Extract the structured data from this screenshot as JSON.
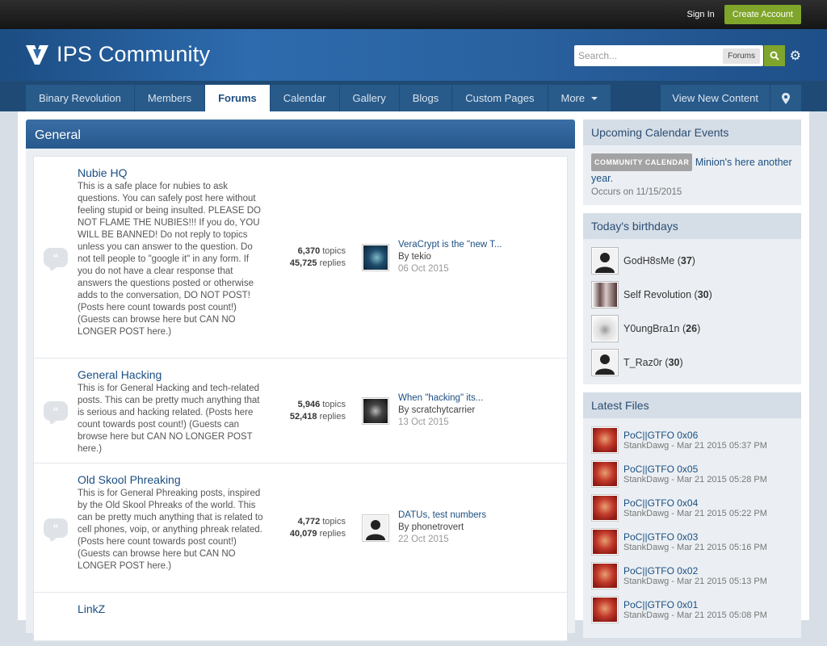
{
  "topbar": {
    "signin": "Sign In",
    "create_account": "Create Account"
  },
  "header": {
    "site_name": "IPS Community",
    "search_placeholder": "Search...",
    "search_scope": "Forums"
  },
  "nav": {
    "tabs": [
      "Binary Revolution",
      "Members",
      "Forums",
      "Calendar",
      "Gallery",
      "Blogs",
      "Custom Pages",
      "More"
    ],
    "active": "Forums",
    "view_new": "View New Content"
  },
  "category": {
    "title": "General",
    "forums": [
      {
        "title": "Nubie HQ",
        "desc": "This is a safe place for nubies to ask questions. You can safely post here without feeling stupid or being insulted. PLEASE DO NOT FLAME THE NUBIES!!! If you do, YOU WILL BE BANNED! Do not reply to topics unless you can answer to the question. Do not tell people to \"google it\" in any form. If you do not have a clear response that answers the questions posted or otherwise adds to the conversation, DO NOT POST! (Posts here count towards post count!) (Guests can browse here but CAN NO LONGER POST here.)",
        "topics": "6,370",
        "replies": "45,725",
        "topics_label": "topics",
        "replies_label": "replies",
        "last_title": "VeraCrypt is the \"new T...",
        "last_by": "By tekio",
        "last_date": "06 Oct 2015"
      },
      {
        "title": "General Hacking",
        "desc": "This is for General Hacking and tech-related posts. This can be pretty much anything that is serious and hacking related. (Posts here count towards post count!) (Guests can browse here but CAN NO LONGER POST here.)",
        "topics": "5,946",
        "replies": "52,418",
        "topics_label": "topics",
        "replies_label": "replies",
        "last_title": "When \"hacking\" its...",
        "last_by": "By scratchytcarrier",
        "last_date": "13 Oct 2015"
      },
      {
        "title": "Old Skool Phreaking",
        "desc": "This is for General Phreaking posts, inspired by the Old Skool Phreaks of the world. This can be pretty much anything that is related to cell phones, voip, or anything phreak related. (Posts here count towards post count!) (Guests can browse here but CAN NO LONGER POST here.)",
        "topics": "4,772",
        "replies": "40,079",
        "topics_label": "topics",
        "replies_label": "replies",
        "last_title": "DATUs, test numbers",
        "last_by": "By phonetrovert",
        "last_date": "22 Oct 2015"
      },
      {
        "title": "LinkZ",
        "desc": "",
        "topics": "",
        "replies": "",
        "topics_label": "",
        "replies_label": "",
        "last_title": "",
        "last_by": "",
        "last_date": ""
      }
    ]
  },
  "sidebar": {
    "calendar": {
      "title": "Upcoming Calendar Events",
      "badge": "COMMUNITY CALENDAR",
      "event": "Minion's here another year.",
      "occurs": "Occurs on 11/15/2015"
    },
    "birthdays": {
      "title": "Today's birthdays",
      "people": [
        {
          "name": "GodH8sMe",
          "age": "37"
        },
        {
          "name": "Self Revolution",
          "age": "30"
        },
        {
          "name": "Y0ungBra1n",
          "age": "26"
        },
        {
          "name": "T_Raz0r",
          "age": "30"
        }
      ]
    },
    "files": {
      "title": "Latest Files",
      "items": [
        {
          "title": "PoC||GTFO 0x06",
          "meta": "StankDawg - Mar 21 2015 05:37 PM"
        },
        {
          "title": "PoC||GTFO 0x05",
          "meta": "StankDawg - Mar 21 2015 05:28 PM"
        },
        {
          "title": "PoC||GTFO 0x04",
          "meta": "StankDawg - Mar 21 2015 05:22 PM"
        },
        {
          "title": "PoC||GTFO 0x03",
          "meta": "StankDawg - Mar 21 2015 05:16 PM"
        },
        {
          "title": "PoC||GTFO 0x02",
          "meta": "StankDawg - Mar 21 2015 05:13 PM"
        },
        {
          "title": "PoC||GTFO 0x01",
          "meta": "StankDawg - Mar 21 2015 05:08 PM"
        }
      ]
    }
  }
}
